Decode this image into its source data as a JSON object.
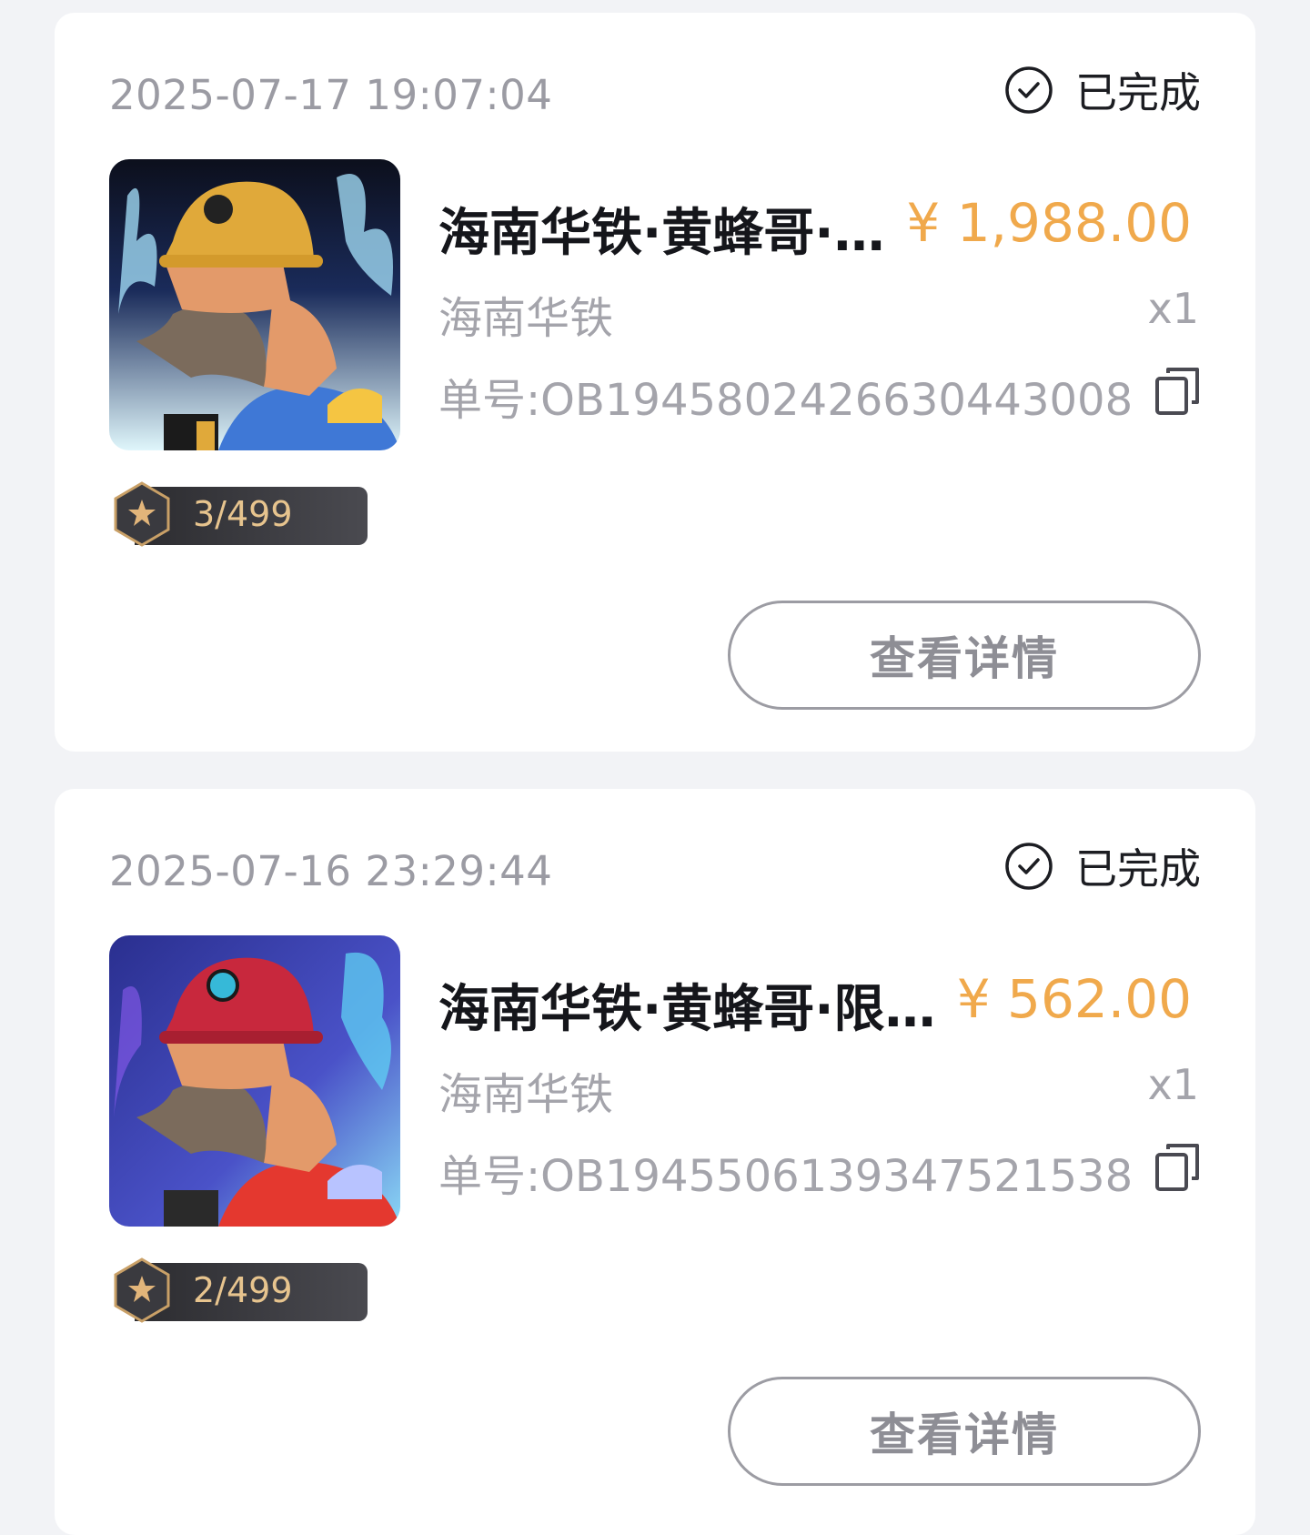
{
  "orders": [
    {
      "time": "2025-07-17 19:07:04",
      "status": "已完成",
      "status_icon": "check-circle-icon",
      "title": "海南华铁·黄蜂哥·限定版数字藏品",
      "price": "¥ 1,988.00",
      "brand": "海南华铁",
      "qty": "x1",
      "order_no": "单号:OB1945802426630443008",
      "edition": "3/499",
      "detail_label": "查看详情",
      "image": {
        "helmet": "#e0a93a",
        "shirt": "#3f78d6",
        "bg_top": "#0c0f1c",
        "flame": "#9fd8f2"
      }
    },
    {
      "time": "2025-07-16 23:29:44",
      "status": "已完成",
      "status_icon": "check-circle-icon",
      "title": "海南华铁·黄蜂哥·限定版数字藏品",
      "price": "¥ 562.00",
      "brand": "海南华铁",
      "qty": "x1",
      "order_no": "单号:OB1945506139347521538",
      "edition": "2/499",
      "detail_label": "查看详情",
      "image": {
        "helmet": "#c8283d",
        "shirt": "#e4382f",
        "bg_top": "#2a2f8f",
        "flame": "#5fd1f4"
      }
    }
  ],
  "colors": {
    "price": "#f0a94c",
    "muted": "#a4a4ab",
    "badge_text": "#e7c48e"
  }
}
